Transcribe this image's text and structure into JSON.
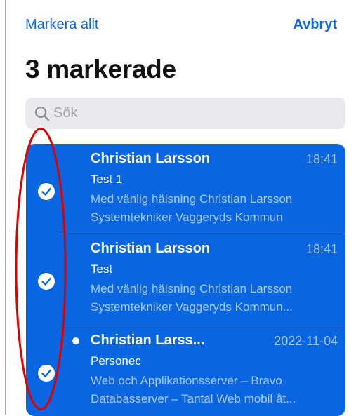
{
  "topbar": {
    "select_all": "Markera allt",
    "cancel": "Avbryt"
  },
  "title": "3 markerade",
  "search": {
    "placeholder": "Sök",
    "value": ""
  },
  "emails": [
    {
      "sender": "Christian Larsson",
      "time": "18:41",
      "subject": "Test 1",
      "preview_line1": "Med vänlig hälsning Christian Larsson",
      "preview_line2": "Systemtekniker Vaggeryds Kommun",
      "selected": true,
      "unread": false
    },
    {
      "sender": "Christian Larsson",
      "time": "18:41",
      "subject": "Test",
      "preview_line1": "Med vänlig hälsning Christian Larsson",
      "preview_line2": "Systemtekniker Vaggeryds Kommun...",
      "selected": true,
      "unread": false
    },
    {
      "sender": "Christian Larss...",
      "time": "2022-11-04",
      "subject": "Personec",
      "preview_line1": "Web och Applikationsserver – Bravo",
      "preview_line2": "Databasserver – Tantal Web mobil åt...",
      "selected": true,
      "unread": true
    }
  ],
  "colors": {
    "accent": "#0a66e0",
    "selection_bg": "#0a66e0",
    "annotation": "#e00000"
  },
  "icons": [
    "search-icon",
    "checkmark-icon",
    "unread-dot-icon"
  ]
}
